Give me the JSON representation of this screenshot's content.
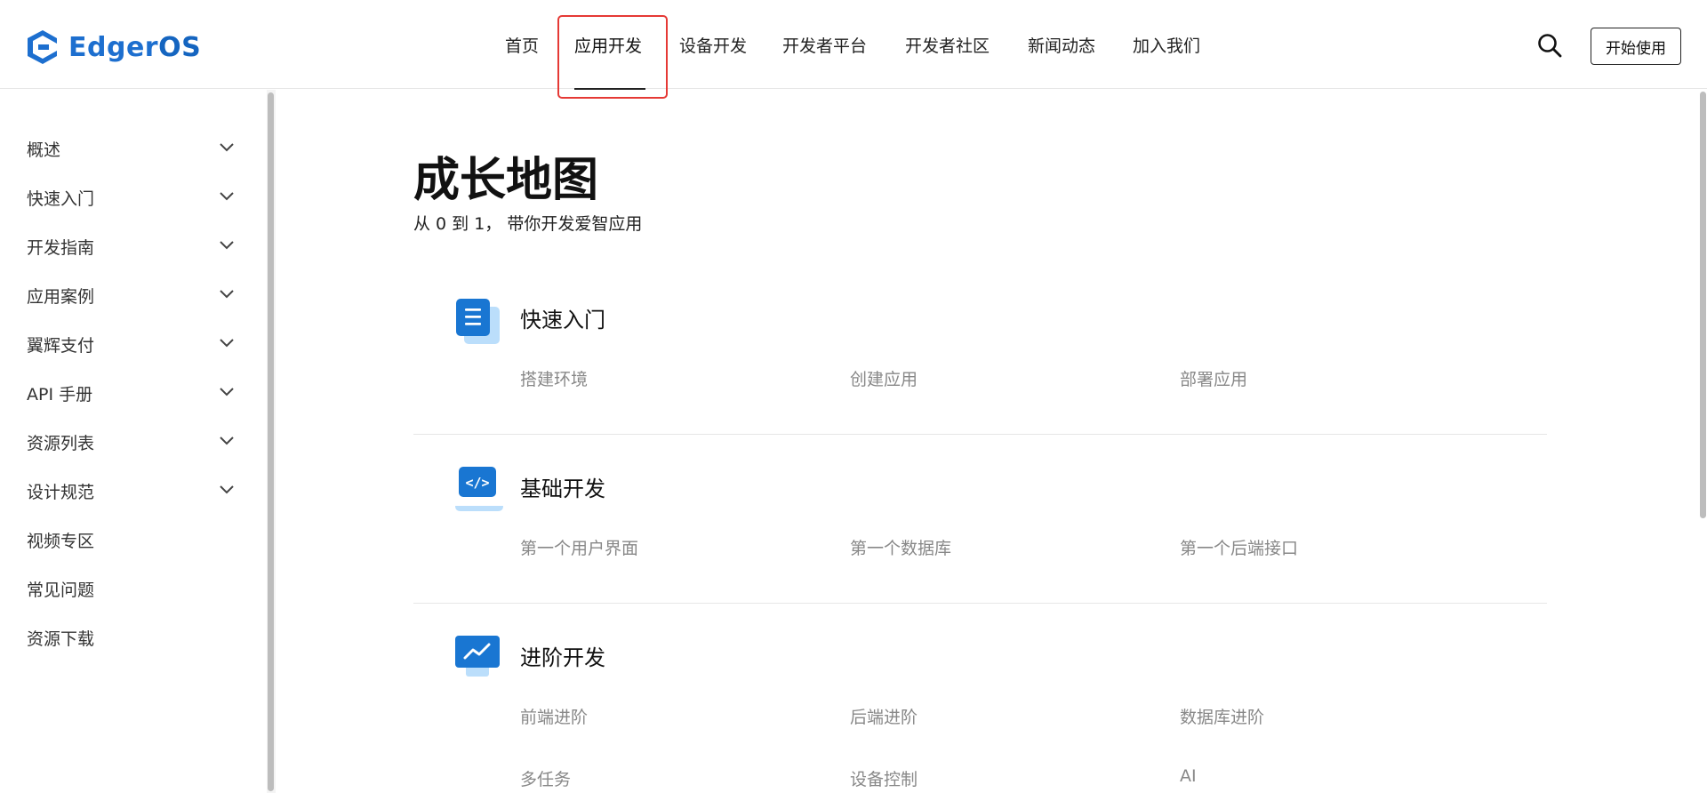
{
  "brand": {
    "name_prefix": "Edger",
    "name_suffix": "OS"
  },
  "nav": {
    "items": [
      {
        "label": "首页"
      },
      {
        "label": "应用开发"
      },
      {
        "label": "设备开发"
      },
      {
        "label": "开发者平台"
      },
      {
        "label": "开发者社区"
      },
      {
        "label": "新闻动态"
      },
      {
        "label": "加入我们"
      }
    ],
    "active_index": 1,
    "start_label": "开始使用"
  },
  "sidebar": {
    "items": [
      {
        "label": "概述",
        "expandable": true
      },
      {
        "label": "快速入门",
        "expandable": true
      },
      {
        "label": "开发指南",
        "expandable": true
      },
      {
        "label": "应用案例",
        "expandable": true
      },
      {
        "label": "翼辉支付",
        "expandable": true
      },
      {
        "label": "API 手册",
        "expandable": true
      },
      {
        "label": "资源列表",
        "expandable": true
      },
      {
        "label": "设计规范",
        "expandable": true
      },
      {
        "label": "视频专区",
        "expandable": false
      },
      {
        "label": "常见问题",
        "expandable": false
      },
      {
        "label": "资源下载",
        "expandable": false
      }
    ]
  },
  "main": {
    "title": "成长地图",
    "subtitle": "从 0 到 1， 带你开发爱智应用",
    "sections": [
      {
        "title": "快速入门",
        "icon": "document-icon",
        "links": [
          "搭建环境",
          "创建应用",
          "部署应用"
        ]
      },
      {
        "title": "基础开发",
        "icon": "code-icon",
        "links": [
          "第一个用户界面",
          "第一个数据库",
          "第一个后端接口"
        ]
      },
      {
        "title": "进阶开发",
        "icon": "chart-monitor-icon",
        "links": [
          "前端进阶",
          "后端进阶",
          "数据库进阶",
          "多任务",
          "设备控制",
          "AI"
        ]
      }
    ]
  },
  "colors": {
    "brand_blue": "#1d6fcf",
    "icon_blue": "#1976d2",
    "icon_light_blue": "#bbdefb",
    "highlight_red": "#e53935"
  }
}
